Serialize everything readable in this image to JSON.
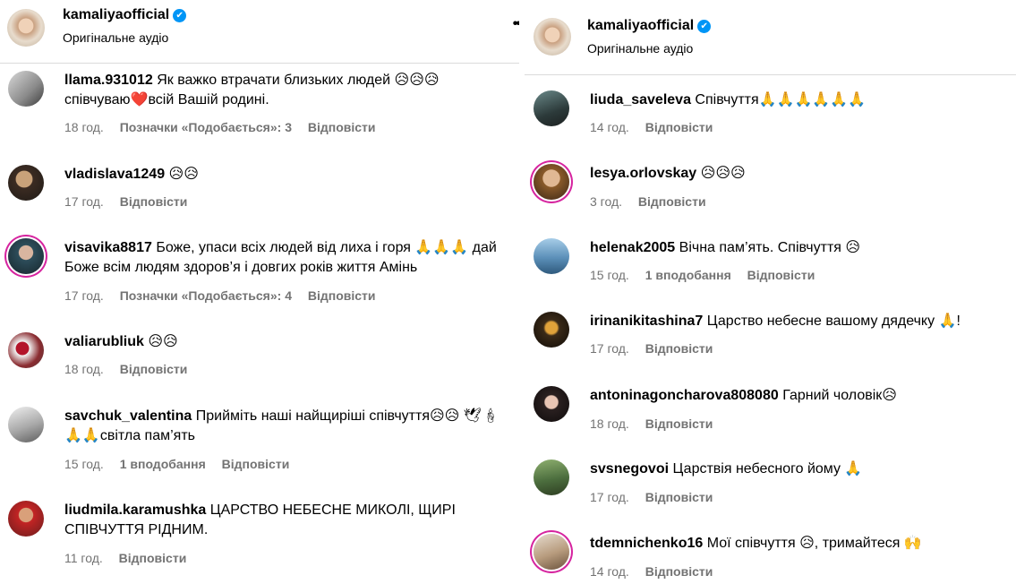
{
  "left": {
    "header": {
      "username": "kamaliyaofficial",
      "subtitle": "Оригінальне аудіо",
      "verified_icon": "✔",
      "more_icon": "••"
    },
    "comments": [
      {
        "username": "llama.931012",
        "text": "Як важко втрачати близьких людей 😥😥😥 співчуваю❤️всій Вашій родині.",
        "time": "18 год.",
        "likes": "Позначки «Подобається»: 3",
        "reply": "Відповісти"
      },
      {
        "username": "vladislava1249",
        "text": "😥😥",
        "time": "17 год.",
        "likes": "",
        "reply": "Відповісти"
      },
      {
        "username": "visavika8817",
        "text": "Боже, упаси всіх людей від лиха і горя 🙏🙏🙏 дай Боже всім людям здоров’я і довгих років життя Амінь",
        "time": "17 год.",
        "likes": "Позначки «Подобається»: 4",
        "reply": "Відповісти"
      },
      {
        "username": "valiarubliuk",
        "text": "😥😥",
        "time": "18 год.",
        "likes": "",
        "reply": "Відповісти"
      },
      {
        "username": "savchuk_valentina",
        "text": "Прийміть наші найщиріші співчуття😥😥 🕊🕯🙏🙏світла пам’ять",
        "time": "15 год.",
        "likes": "1 вподобання",
        "reply": "Відповісти"
      },
      {
        "username": "liudmila.karamushka",
        "text": "ЦАРСТВО НЕБЕСНЕ МИКОЛІ, ЩИРІ СПІВЧУТТЯ РІДНИМ.",
        "time": "11 год.",
        "likes": "",
        "reply": "Відповісти"
      }
    ]
  },
  "right": {
    "header": {
      "username": "kamaliyaofficial",
      "subtitle": "Оригінальне аудіо",
      "verified_icon": "✔"
    },
    "comments": [
      {
        "username": "liuda_saveleva",
        "text": "Співчуття🙏🙏🙏🙏🙏🙏",
        "time": "14 год.",
        "likes": "",
        "reply": "Відповісти"
      },
      {
        "username": "lesya.orlovskay",
        "text": "😥😥😥",
        "time": "3 год.",
        "likes": "",
        "reply": "Відповісти"
      },
      {
        "username": "helenak2005",
        "text": "Вічна пам’ять. Співчуття 😥",
        "time": "15 год.",
        "likes": "1 вподобання",
        "reply": "Відповісти"
      },
      {
        "username": "irinanikitashina7",
        "text": "Царство небесне вашому дядечку 🙏!",
        "time": "17 год.",
        "likes": "",
        "reply": "Відповісти"
      },
      {
        "username": "antoninagoncharova808080",
        "text": "Гарний чоловік😥",
        "time": "18 год.",
        "likes": "",
        "reply": "Відповісти"
      },
      {
        "username": "svsnegovoi",
        "text": "Царствія небесного йому 🙏",
        "time": "17 год.",
        "likes": "",
        "reply": "Відповісти"
      },
      {
        "username": "tdemnichenko16",
        "text": "Мої співчуття 😥, тримайтеся 🙌",
        "time": "14 год.",
        "likes": "",
        "reply": "Відповісти"
      }
    ]
  }
}
